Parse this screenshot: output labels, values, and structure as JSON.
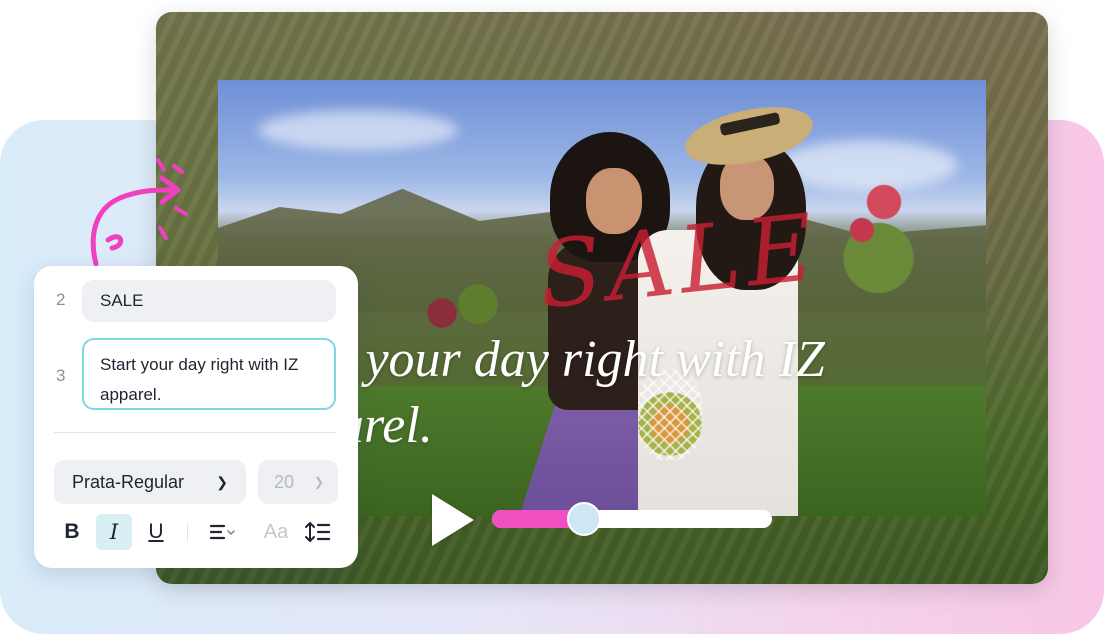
{
  "editor": {
    "rows": [
      {
        "number": "2",
        "text": "SALE"
      },
      {
        "number": "3",
        "text": "Start your day right with IZ apparel."
      }
    ],
    "font": {
      "family_label": "Prata-Regular",
      "size": "20"
    },
    "toolbar": {
      "bold": "B",
      "italic": "I",
      "underline": "U",
      "case": "Aa"
    }
  },
  "preview": {
    "overlay_sale": "SALE",
    "overlay_line1": "t your day right with IZ",
    "overlay_line2": "arel.",
    "progress": 0.33
  },
  "colors": {
    "accent_pink": "#f04fc2",
    "accent_cyan": "#7ed8e3",
    "sale_red": "#c81e32"
  }
}
